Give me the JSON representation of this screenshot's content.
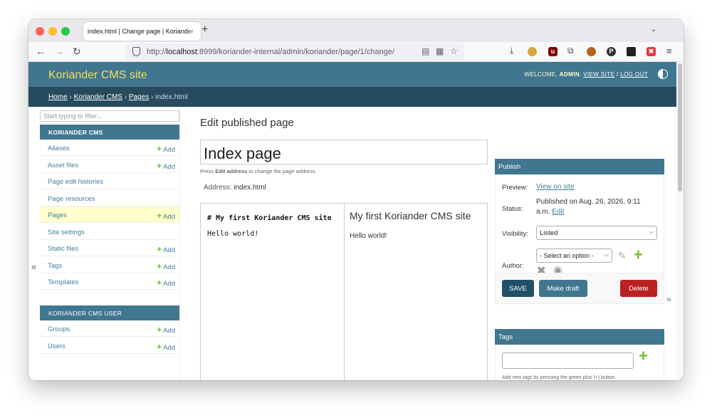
{
  "browser": {
    "tab_title": "index.html | Change page | Koriander",
    "new_tab_glyph": "+",
    "url_prefix": "http://",
    "url_host": "localhost",
    "url_rest": ":8999/koriander-internal/admin/koriander/page/1/change/"
  },
  "header": {
    "site_name": "Koriander CMS site",
    "welcome": "WELCOME, ",
    "user": "ADMIN",
    "view_site": "VIEW SITE",
    "separator": " / ",
    "log_out": "LOG OUT"
  },
  "breadcrumbs": {
    "home": "Home",
    "app": "Koriander CMS",
    "model": "Pages",
    "current": "index.html",
    "sep": "›"
  },
  "sidebar": {
    "filter_placeholder": "Start typing to filter...",
    "add_label": "Add",
    "module1": {
      "caption": "KORIANDER CMS",
      "items": [
        {
          "label": "Aliases",
          "add": true
        },
        {
          "label": "Asset files",
          "add": true
        },
        {
          "label": "Page edit histories",
          "add": false
        },
        {
          "label": "Page resources",
          "add": false
        },
        {
          "label": "Pages",
          "add": true,
          "current": true
        },
        {
          "label": "Site settings",
          "add": false
        },
        {
          "label": "Static files",
          "add": true
        },
        {
          "label": "Tags",
          "add": true
        },
        {
          "label": "Templates",
          "add": true
        }
      ]
    },
    "module2": {
      "caption": "KORIANDER CMS USER",
      "items": [
        {
          "label": "Groups",
          "add": true
        },
        {
          "label": "Users",
          "add": true
        }
      ]
    },
    "collapse_glyph": "«"
  },
  "main": {
    "heading": "Edit published page",
    "title_value": "Index page",
    "help_prefix": "Press ",
    "help_bold": "Edit address",
    "help_suffix": " to change the page address.",
    "address_label": "Address:",
    "address_value": "index.html",
    "markdown_heading": "# My first Koriander CMS site",
    "markdown_body": "Hello world!",
    "preview_heading": "My first Koriander CMS site",
    "preview_body": "Hello world!"
  },
  "publish": {
    "caption": "Publish",
    "preview_label": "Preview:",
    "preview_link": "View on site",
    "status_label": "Status:",
    "status_text": "Published on Aug. 26, 2026, 9:11 a.m.",
    "status_edit": "Edit",
    "visibility_label": "Visibility:",
    "visibility_value": "Listed",
    "author_label": "Author:",
    "author_value": "- Select an option -",
    "save": "SAVE",
    "make_draft": "Make draft",
    "delete": "Delete",
    "expand_glyph": "»"
  },
  "tags": {
    "caption": "Tags",
    "help": "Add new tags by pressing the green plus (+) button."
  },
  "colors": {
    "header_bg": "#417690",
    "breadcrumb_bg": "#264b5d",
    "site_name": "#f5dd5d",
    "link": "#447e9b",
    "add_green": "#70bf2b",
    "delete_red": "#ba2121",
    "save_dark": "#205067"
  }
}
